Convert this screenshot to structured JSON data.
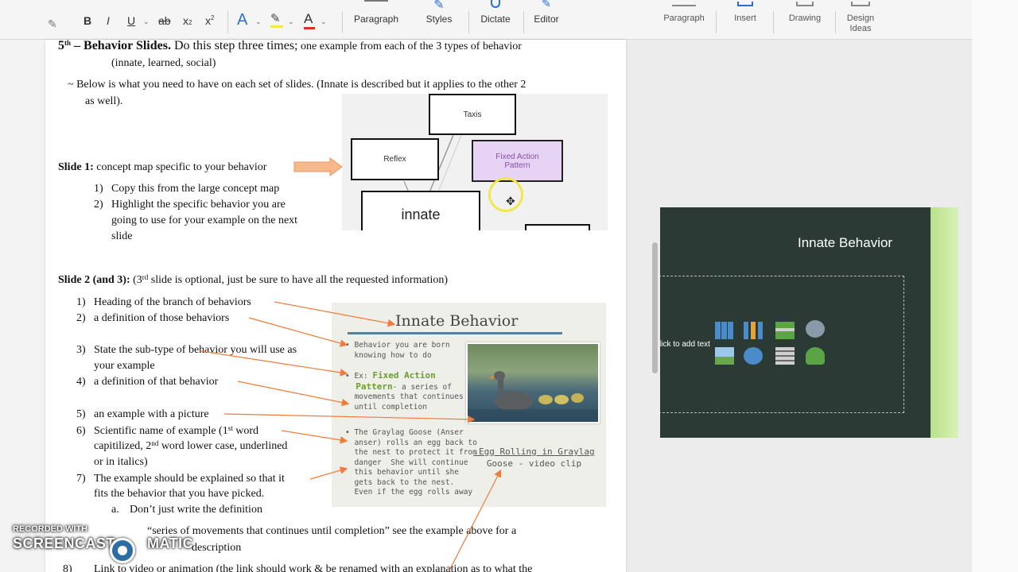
{
  "word": {
    "ribbon": {
      "format_buttons": [
        "B",
        "I",
        "U",
        "ab",
        "x",
        "x"
      ],
      "font_color_a": "A",
      "highlight_a": "A",
      "groups": [
        "Paragraph",
        "Styles",
        "Dictate",
        "Editor"
      ]
    },
    "doc": {
      "step_heading": {
        "prefix": "5",
        "prefix_sup": "th",
        "title": " – Behavior Slides.",
        "text": " Do this step three times;",
        "tail": " one example from each of the 3 types of behavior",
        "line2": "(innate, learned, social)"
      },
      "intro": {
        "line1": "~ Below is what you need to have on each set of slides.  (Innate is described but it applies to the other 2",
        "line2": "as well)."
      },
      "slide1": {
        "label": "Slide 1:",
        "text": " concept map specific to your behavior",
        "items": [
          {
            "num": "1)",
            "text": "Copy this from the large concept map"
          },
          {
            "num": "2)",
            "text": "Highlight the specific behavior you are"
          },
          {
            "num": "",
            "text": "going to use for your example on the next"
          },
          {
            "num": "",
            "text": "slide"
          }
        ]
      },
      "concept_map": {
        "nodes": {
          "taxis": "Taxis",
          "reflex": "Reflex",
          "fap_line1": "Fixed Action",
          "fap_line2": "Pattern",
          "innate": "innate"
        }
      },
      "slide2": {
        "label": "Slide 2 (and 3):",
        "text_a": " (3",
        "text_sup": "rd",
        "text_b": " slide is optional, just be sure to have all the requested information)",
        "items": [
          {
            "num": "1)",
            "text": "Heading of the branch of behaviors"
          },
          {
            "num": "2)",
            "text": "a definition of those behaviors"
          },
          {
            "num": "3)",
            "text": "State the sub-type of behavior you will use as"
          },
          {
            "num": "",
            "text": "your example"
          },
          {
            "num": "4)",
            "text": "a definition of that behavior"
          },
          {
            "num": "5)",
            "text": "an example with a picture"
          },
          {
            "num": "6)",
            "text_a": "Scientific name of example (1",
            "sup1": "st",
            "text_b": " word"
          },
          {
            "num": "",
            "text_a": "capitilized, 2",
            "sup1": "nd",
            "text_b": " word lower case, underlined"
          },
          {
            "num": "",
            "text": "or in italics)"
          },
          {
            "num": "7)",
            "text": "The example should be explained so that it"
          },
          {
            "num": "",
            "text": "fits the behavior that you have picked."
          },
          {
            "num": "a.",
            "text": "Don’t just write the definition"
          }
        ],
        "after_line1": "“series of movements that continues until completion” see the example above for a",
        "after_line2": "description",
        "item8_num": "8)",
        "item8_text": "Link to video or animation (the link should work & be renamed with an explanation as to what the"
      },
      "slide_image": {
        "title": "Innate Behavior",
        "bullet1": "• Behavior you are born\n  knowing how to do",
        "bullet2_prefix": "• Ex: ",
        "bullet2_green": "Fixed Action\n  Pattern",
        "bullet2_rest": "- a series of\n  movements that continues\n  until completion",
        "bullet3": "• The Graylag Goose (Anser\n  anser) rolls an egg back to\n  the nest to protect it from\n  danger  She will continue\n  this behavior until she\n  gets back to the nest.\n  Even if the egg rolls away",
        "caption_line1": ".Egg Rolling in Graylag",
        "caption_line2": "Goose - video clip"
      }
    }
  },
  "ppt": {
    "ribbon": {
      "groups": [
        "Paragraph",
        "Insert",
        "Drawing",
        "Design\nIdeas"
      ]
    },
    "slide": {
      "title": "Innate Behavior",
      "placeholder": "lick to add text"
    }
  },
  "watermark": {
    "top": "RECORDED WITH",
    "bottom_left": "SCREENCAST",
    "bottom_right": "MATIC"
  },
  "colors": {
    "arrow_orange": "#f07b3a",
    "slide_bg": "#2c3a36",
    "slide_accent": "#b9e08a",
    "highlight_purple": "#e7d3f3"
  }
}
